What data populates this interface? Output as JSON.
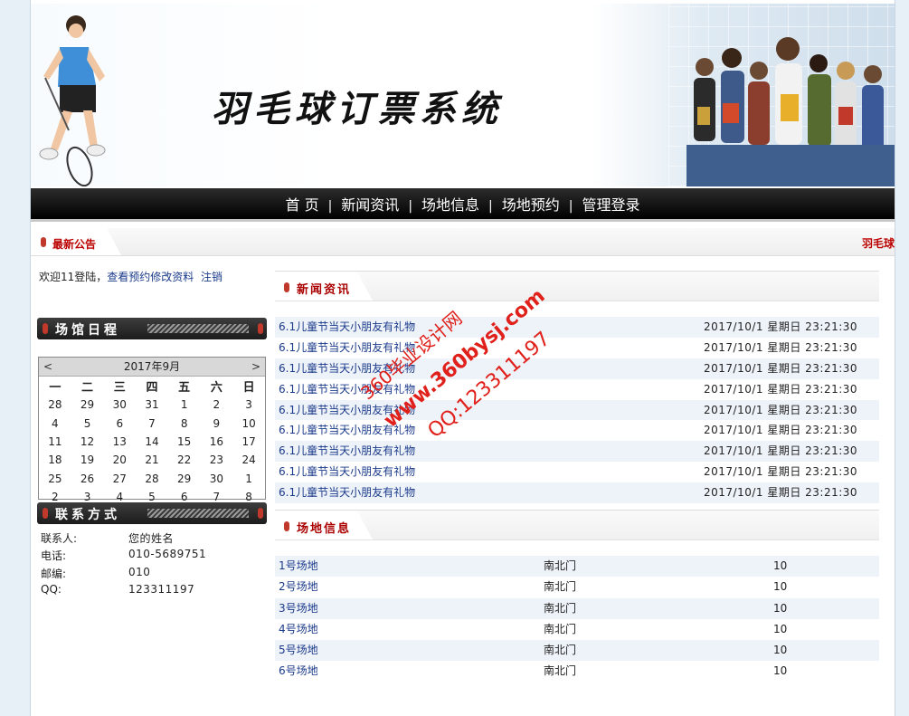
{
  "banner": {
    "title": "羽毛球订票系统"
  },
  "nav": {
    "items": [
      "首 页",
      "新闻资讯",
      "场地信息",
      "场地预约",
      "管理登录"
    ],
    "separator": "|"
  },
  "notice": {
    "title": "最新公告",
    "scroll_text": "羽毛球"
  },
  "welcome": {
    "text": "欢迎11登陆，",
    "link1": "查看预约",
    "link2": "修改资料",
    "link3": "注销"
  },
  "schedule": {
    "title": "场馆日程",
    "month_label": "2017年9月",
    "prev": "<",
    "next": ">",
    "weekdays": [
      "一",
      "二",
      "三",
      "四",
      "五",
      "六",
      "日"
    ],
    "weeks": [
      [
        "28",
        "29",
        "30",
        "31",
        "1",
        "2",
        "3"
      ],
      [
        "4",
        "5",
        "6",
        "7",
        "8",
        "9",
        "10"
      ],
      [
        "11",
        "12",
        "13",
        "14",
        "15",
        "16",
        "17"
      ],
      [
        "18",
        "19",
        "20",
        "21",
        "22",
        "23",
        "24"
      ],
      [
        "25",
        "26",
        "27",
        "28",
        "29",
        "30",
        "1"
      ],
      [
        "2",
        "3",
        "4",
        "5",
        "6",
        "7",
        "8"
      ]
    ]
  },
  "contact": {
    "title": "联系方式",
    "rows": [
      {
        "k": "联系人:",
        "v": "您的姓名"
      },
      {
        "k": "电话:",
        "v": "010-5689751"
      },
      {
        "k": "邮编:",
        "v": "010"
      },
      {
        "k": "QQ:",
        "v": "123311197"
      }
    ]
  },
  "news": {
    "title": "新闻资讯",
    "items": [
      {
        "title": "6.1儿童节当天小朋友有礼物",
        "date": "2017/10/1 星期日 23:21:30"
      },
      {
        "title": "6.1儿童节当天小朋友有礼物",
        "date": "2017/10/1 星期日 23:21:30"
      },
      {
        "title": "6.1儿童节当天小朋友有礼物",
        "date": "2017/10/1 星期日 23:21:30"
      },
      {
        "title": "6.1儿童节当天小朋友有礼物",
        "date": "2017/10/1 星期日 23:21:30"
      },
      {
        "title": "6.1儿童节当天小朋友有礼物",
        "date": "2017/10/1 星期日 23:21:30"
      },
      {
        "title": "6.1儿童节当天小朋友有礼物",
        "date": "2017/10/1 星期日 23:21:30"
      },
      {
        "title": "6.1儿童节当天小朋友有礼物",
        "date": "2017/10/1 星期日 23:21:30"
      },
      {
        "title": "6.1儿童节当天小朋友有礼物",
        "date": "2017/10/1 星期日 23:21:30"
      },
      {
        "title": "6.1儿童节当天小朋友有礼物",
        "date": "2017/10/1 星期日 23:21:30"
      }
    ]
  },
  "venues": {
    "title": "场地信息",
    "items": [
      {
        "name": "1号场地",
        "location": "南北门",
        "count": "10"
      },
      {
        "name": "2号场地",
        "location": "南北门",
        "count": "10"
      },
      {
        "name": "3号场地",
        "location": "南北门",
        "count": "10"
      },
      {
        "name": "4号场地",
        "location": "南北门",
        "count": "10"
      },
      {
        "name": "5号场地",
        "location": "南北门",
        "count": "10"
      },
      {
        "name": "6号场地",
        "location": "南北门",
        "count": "10"
      }
    ]
  },
  "watermark": {
    "line1": "360毕业设计网",
    "line2": "www.360bysj.com",
    "line3": "QQ:123311197"
  },
  "colors": {
    "accent": "#c0392b",
    "link": "#1a3a8a",
    "nav_bg": "#000000",
    "row_alt": "#eef2f9"
  }
}
